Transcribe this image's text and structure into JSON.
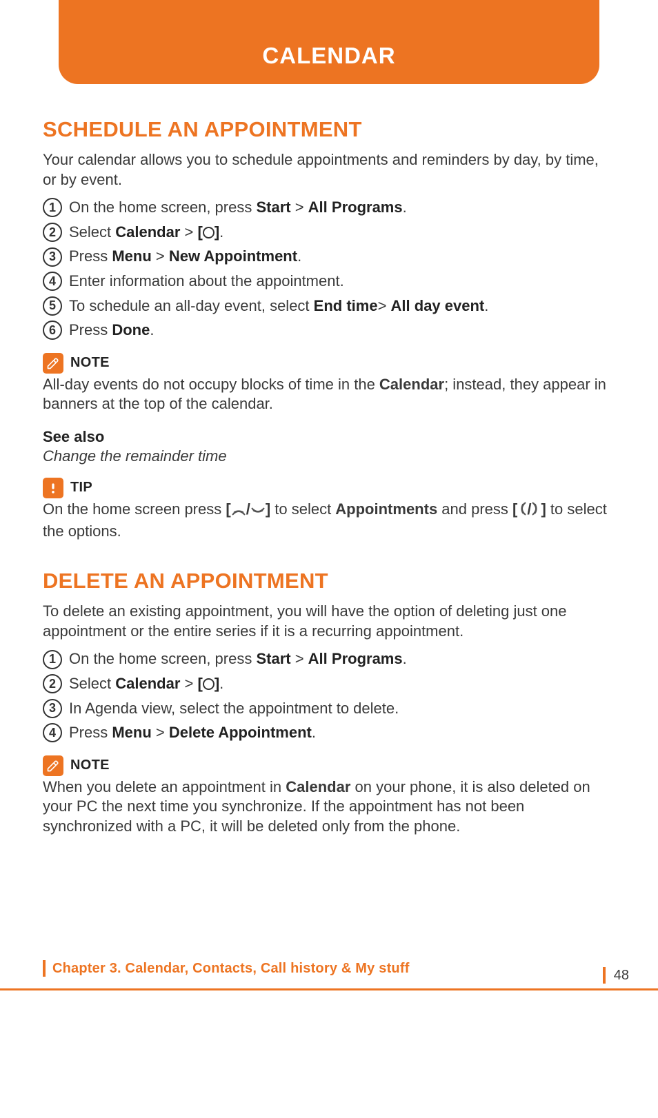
{
  "header": {
    "title": "CALENDAR"
  },
  "section1": {
    "title": "SCHEDULE AN APPOINTMENT",
    "intro": "Your calendar allows you to schedule appointments and reminders by day, by time, or by event.",
    "steps": [
      {
        "pre": "On the home screen, press ",
        "b1": "Start",
        "mid1": " > ",
        "b2": "All Programs",
        "post": "."
      },
      {
        "pre": "Select ",
        "b1": "Calendar",
        "mid1": " > ",
        "b2": "[",
        "ok": true,
        "b3": "]",
        "post": "."
      },
      {
        "pre": "Press ",
        "b1": "Menu",
        "mid1": " > ",
        "b2": "New Appointment",
        "post": "."
      },
      {
        "pre": "Enter information about the appointment."
      },
      {
        "pre": "To schedule an all-day event, select ",
        "b1": "End time",
        "mid1": "> ",
        "b2": "All day event",
        "post": "."
      },
      {
        "pre": "Press ",
        "b1": "Done",
        "post": "."
      }
    ],
    "note_label": "NOTE",
    "note_body_pre": "All-day events do not occupy blocks of time in the ",
    "note_body_bold": "Calendar",
    "note_body_post": "; instead, they appear in banners at the top of the calendar.",
    "see_also_label": "See also",
    "see_also_text": "Change the remainder time",
    "tip_label": "TIP",
    "tip_pre": "On the home screen press ",
    "tip_b1": "[",
    "tip_mid1": "/",
    "tip_b2": "]",
    "tip_mid2": " to select ",
    "tip_b3": "Appointments",
    "tip_mid3": " and press ",
    "tip_b4": "[",
    "tip_mid4": "/",
    "tip_b5": "]",
    "tip_post": " to select the options."
  },
  "section2": {
    "title": "DELETE AN APPOINTMENT",
    "intro": "To delete an existing appointment, you will have the option of deleting just one appointment or the entire series if it is a recurring appointment.",
    "steps": [
      {
        "pre": "On the home screen, press ",
        "b1": "Start",
        "mid1": " > ",
        "b2": "All Programs",
        "post": "."
      },
      {
        "pre": "Select ",
        "b1": "Calendar",
        "mid1": " > ",
        "b2": "[",
        "ok": true,
        "b3": "]",
        "post": "."
      },
      {
        "pre": "In Agenda view, select the appointment to delete."
      },
      {
        "pre": "Press ",
        "b1": "Menu",
        "mid1": " > ",
        "b2": "Delete Appointment",
        "post": "."
      }
    ],
    "note_label": "NOTE",
    "note_body_pre": "When you delete an appointment in ",
    "note_body_bold": "Calendar",
    "note_body_post": " on your phone, it is also deleted on your PC the next time you synchronize. If the appointment has not been synchronized with a PC, it will be deleted only from the phone."
  },
  "footer": {
    "chapter": "Chapter 3. Calendar, Contacts, Call history & My stuff",
    "page": "48"
  }
}
